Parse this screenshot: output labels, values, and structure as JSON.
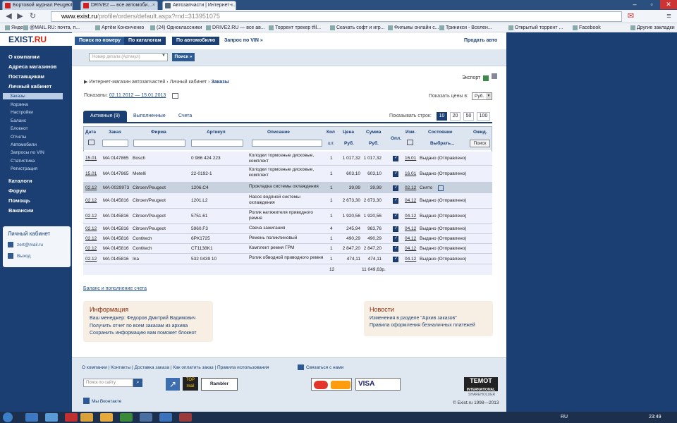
{
  "browser": {
    "tabs": [
      "Бортовой журнал Peugeot",
      "DRIVE2 — все автомоби...",
      "Автозапчасти | Интернет-..."
    ],
    "url_host": "www.exist.ru",
    "url_path": "/profile/orders/default.aspx?rnd=313951075",
    "bookmarks": [
      "Яндекс",
      "@MAIL.RU: почта, п...",
      "Артём Кононченко",
      "(24) Одноклассники",
      "DRIVE2.RU — все ав...",
      "Торрент трекер tfil...",
      "Скачать софт и игр...",
      "Фильмы онлайн с...",
      "Триникси - Вселен...",
      "Открытый торрент ...",
      "Facebook",
      "Другие закладки"
    ]
  },
  "logo": {
    "left": "EXIST",
    "right": ".RU"
  },
  "sidebar": {
    "items": [
      "О компании",
      "Адреса магазинов",
      "Поставщикам",
      "Личный кабинет"
    ],
    "sub": [
      "Заказы",
      "Корзина",
      "Настройки",
      "Баланс",
      "Блокнот",
      "Отчеты",
      "Автомобили",
      "Запросы по VIN",
      "Статистика",
      "Регистрация"
    ],
    "items2": [
      "Каталоги",
      "Форум",
      "Помощь",
      "Вакансии"
    ],
    "lk_title": "Личный кабинет",
    "lk_email": "zert@mail.ru",
    "lk_exit": "Выход"
  },
  "topnav": {
    "t1": "Поиск по номеру",
    "t2": "По каталогам",
    "t3": "По автомобилю",
    "t4": "Запрос по VIN »",
    "right": "Продать авто"
  },
  "search": {
    "placeholder": "Номер детали (Артикул)",
    "button": "Поиск »"
  },
  "breadcrumb": {
    "b1": "Интернет-магазин автозапчастей",
    "b2": "Личный кабинет",
    "b3": "Заказы"
  },
  "export": "Экспорт",
  "shown": {
    "label": "Показаны:",
    "range": "02.11.2012 — 15.01.2013"
  },
  "prices": {
    "label": "Показать цены в:",
    "value": "Руб."
  },
  "tabs": {
    "active": "Активные (9)",
    "done": "Выполненные",
    "bills": "Счета"
  },
  "rows_per_page": {
    "label": "Показывать строк:",
    "options": [
      "10",
      "20",
      "50",
      "100"
    ]
  },
  "table": {
    "headers": [
      "Дата",
      "Заказ",
      "Фирма",
      "Артикул",
      "Описание",
      "Кол",
      "Цена",
      "Сумма",
      "Опл.",
      "Изм.",
      "Состояние",
      "Ожид."
    ],
    "sub": {
      "qty": "шт.",
      "price": "Руб.",
      "sum": "Руб.",
      "state": "Выбрать...",
      "search": "Поиск"
    },
    "rows": [
      {
        "date": "15.01",
        "order": "MA 0147865",
        "brand": "Bosch",
        "art": "0 986 424 223",
        "desc": "Колодки тормозные дисковые, комплект",
        "qty": "1",
        "price": "1 017,32",
        "sum": "1 017,32",
        "chg": "16.01",
        "state": "Выдано (Отправлено)"
      },
      {
        "date": "15.01",
        "order": "MA 0147865",
        "brand": "Metelli",
        "art": "22-0192-1",
        "desc": "Колодки тормозные дисковые, комплект",
        "qty": "1",
        "price": "603,10",
        "sum": "603,10",
        "chg": "16.01",
        "state": "Выдано (Отправлено)"
      },
      {
        "date": "02.12",
        "order": "MA-0029973",
        "brand": "Citroen/Peugeot",
        "art": "1206.C4",
        "desc": "Прокладка системы охлаждения",
        "qty": "1",
        "price": "39,99",
        "sum": "39,99",
        "chg": "02.12",
        "state": "Снято"
      },
      {
        "date": "02.12",
        "order": "MA 0145816",
        "brand": "Citroen/Peugeot",
        "art": "1201.L2",
        "desc": "Насос водяной системы охлаждения",
        "qty": "1",
        "price": "2 673,30",
        "sum": "2 673,30",
        "chg": "04.12",
        "state": "Выдано (Отправлено)"
      },
      {
        "date": "02.12",
        "order": "MA 0145816",
        "brand": "Citroen/Peugeot",
        "art": "5751.61",
        "desc": "Ролик натяжителя приводного ремня",
        "qty": "1",
        "price": "1 920,56",
        "sum": "1 920,56",
        "chg": "04.12",
        "state": "Выдано (Отправлено)"
      },
      {
        "date": "02.12",
        "order": "MA 0145816",
        "brand": "Citroen/Peugeot",
        "art": "5960.F3",
        "desc": "Свеча зажигания",
        "qty": "4",
        "price": "245,94",
        "sum": "983,76",
        "chg": "04.12",
        "state": "Выдано (Отправлено)"
      },
      {
        "date": "02.12",
        "order": "MA 0145816",
        "brand": "Contitech",
        "art": "6PK1725",
        "desc": "Ремень поликлиновый",
        "qty": "1",
        "price": "490,29",
        "sum": "490,29",
        "chg": "04.12",
        "state": "Выдано (Отправлено)"
      },
      {
        "date": "02.12",
        "order": "MA 0145816",
        "brand": "Contitech",
        "art": "CT1138K1",
        "desc": "Комплект ремня ГРМ",
        "qty": "1",
        "price": "2 847,20",
        "sum": "2 847,20",
        "chg": "04.12",
        "state": "Выдано (Отправлено)"
      },
      {
        "date": "02.12",
        "order": "MA 0145816",
        "brand": "Ina",
        "art": "532 0439 10",
        "desc": "Ролик обводной приводного ремня",
        "qty": "1",
        "price": "474,11",
        "sum": "474,11",
        "chg": "04.12",
        "state": "Выдано (Отправлено)"
      }
    ],
    "total_qty": "12",
    "total_sum": "11 049,63р."
  },
  "balance_link": "Баланс и пополнение счета",
  "info": {
    "title": "Информация",
    "l1": "Ваш менеджер: Федоров Дмитрий Вадимович",
    "l2": "Получить отчет по всем заказам из архива",
    "l3": "Сохранить информацию вам поможет блокнот"
  },
  "news": {
    "title": "Новости",
    "l1": "Изменения в разделе \"Архив заказов\"",
    "l2": "Правила оформления безналичных платежей"
  },
  "footer": {
    "links": [
      "О компании",
      "Контакты",
      "Доставка заказа",
      "Как оплатить заказ",
      "Правила использования"
    ],
    "contact": "Связаться с нами",
    "site_search": "Поиск по сайту",
    "vk": "Мы Вконтакте",
    "copyright": "© Exist.ru 1998—2013",
    "temot": "TEMOT",
    "temot_sub": "INTERNATIONAL",
    "temot_share": "SHAREHOLDER"
  },
  "taskbar": {
    "lang": "RU",
    "time": "23:49"
  },
  "colors": {
    "navy": "#1b3f73",
    "accent": "#2d5a92",
    "row": "#eef0fb",
    "highlight": "#c7d2de"
  }
}
